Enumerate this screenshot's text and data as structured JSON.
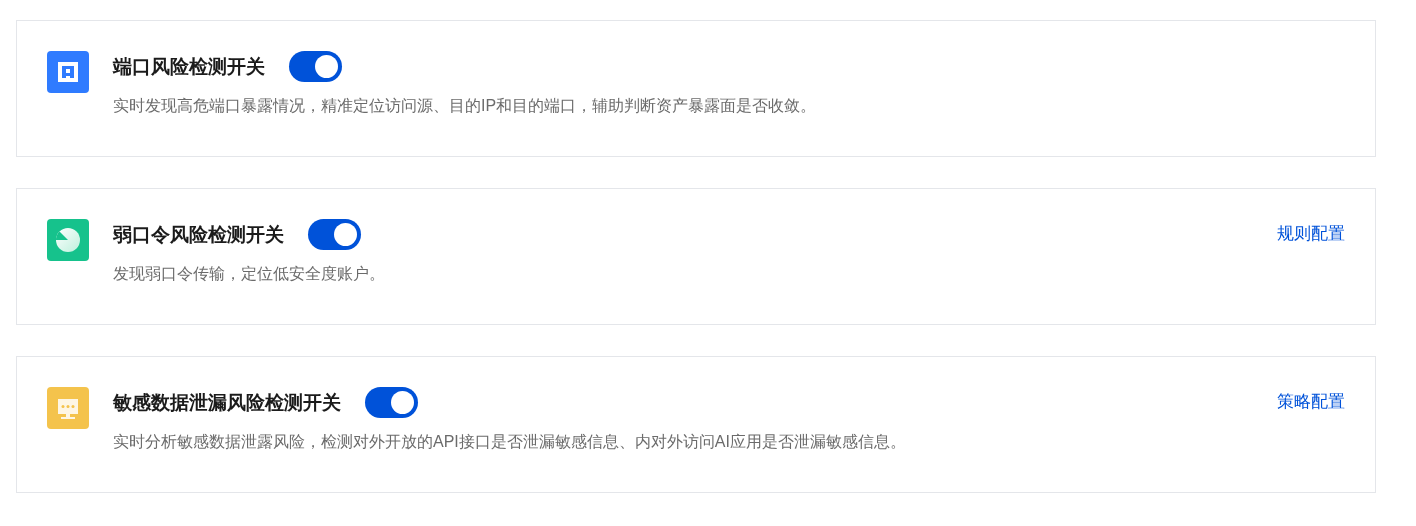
{
  "items": [
    {
      "kind": "port",
      "color": "#2f7bff",
      "title": "端口风险检测开关",
      "on": true,
      "description": "实时发现高危端口暴露情况，精准定位访问源、目的IP和目的端口，辅助判断资产暴露面是否收敛。"
    },
    {
      "kind": "password",
      "color": "#16c28c",
      "title": "弱口令风险检测开关",
      "on": true,
      "description": "发现弱口令传输，定位低安全度账户。",
      "link": "规则配置"
    },
    {
      "kind": "data",
      "color": "#f4c34c",
      "title": "敏感数据泄漏风险检测开关",
      "on": true,
      "description": "实时分析敏感数据泄露风险，检测对外开放的API接口是否泄漏敏感信息、内对外访问AI应用是否泄漏敏感信息。",
      "link": "策略配置"
    }
  ]
}
